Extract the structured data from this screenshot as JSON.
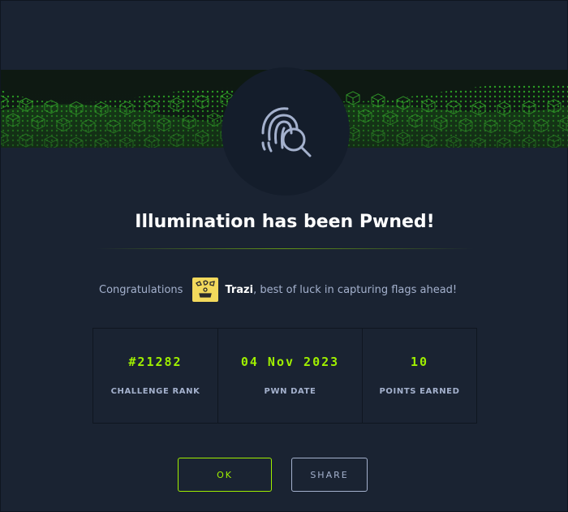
{
  "banner": {
    "image": "green-voxel-wave-banner"
  },
  "emblem": {
    "icon": "fingerprint-search-icon"
  },
  "title": "Illumination has been Pwned!",
  "congrats": {
    "prefix": "Congratulations",
    "username": "Trazi",
    "suffix": ", best of luck in capturing flags ahead!",
    "avatar_icon": "user-avatar"
  },
  "stats": [
    {
      "value": "#21282",
      "label": "CHALLENGE RANK"
    },
    {
      "value": "04 Nov 2023",
      "label": "PWN DATE"
    },
    {
      "value": "10",
      "label": "POINTS EARNED"
    }
  ],
  "buttons": {
    "ok": "OK",
    "share": "SHARE"
  },
  "colors": {
    "accent": "#9fef00",
    "background": "#1a2332",
    "muted": "#a4b1cd"
  }
}
